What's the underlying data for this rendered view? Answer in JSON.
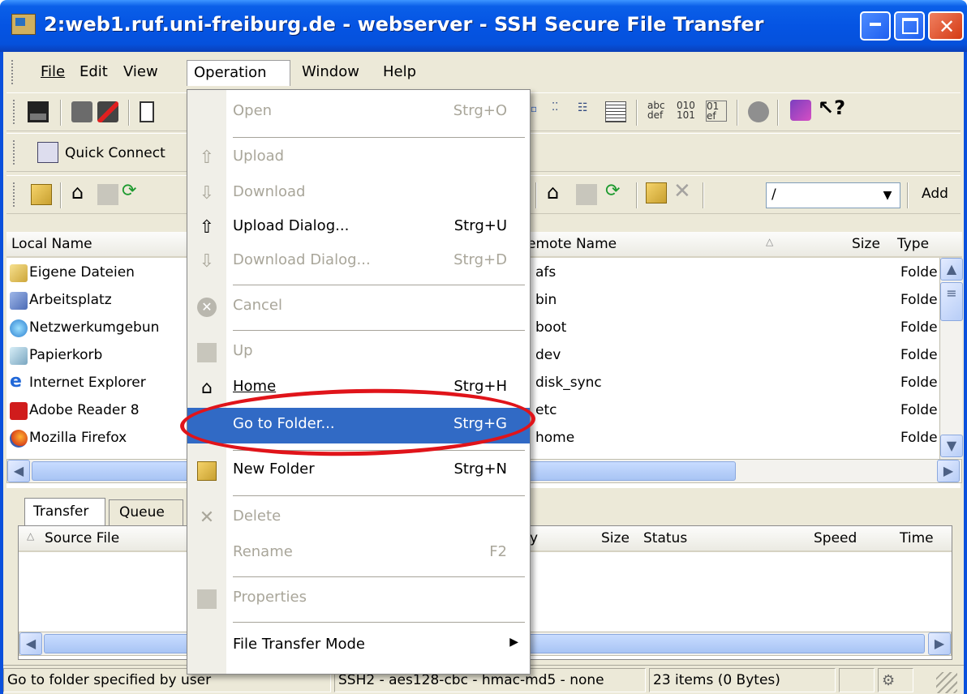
{
  "window": {
    "title": "2:web1.ruf.uni-freiburg.de - webserver - SSH Secure File Transfer",
    "minimize_label": "_",
    "maximize_label": "□",
    "close_label": "✕"
  },
  "menubar": {
    "items": [
      "File",
      "Edit",
      "View",
      "Operation",
      "Window",
      "Help"
    ],
    "active": "Operation"
  },
  "toolbar2": {
    "quick_connect": "Quick Connect"
  },
  "remote_toolbar": {
    "path_value": "/",
    "add_label": "Add"
  },
  "local_pane": {
    "header": "Local Name",
    "items": [
      "Eigene Dateien",
      "Arbeitsplatz",
      "Netzwerkumgebun",
      "Papierkorb",
      "Internet Explorer",
      "Adobe Reader 8",
      "Mozilla Firefox"
    ]
  },
  "remote_pane": {
    "headers": {
      "name": "emote Name",
      "size": "Size",
      "type": "Type"
    },
    "items": [
      {
        "name": "afs",
        "type": "Folde"
      },
      {
        "name": "bin",
        "type": "Folde"
      },
      {
        "name": "boot",
        "type": "Folde"
      },
      {
        "name": "dev",
        "type": "Folde"
      },
      {
        "name": "disk_sync",
        "type": "Folde"
      },
      {
        "name": "etc",
        "type": "Folde"
      },
      {
        "name": "home",
        "type": "Folde"
      }
    ]
  },
  "transfer": {
    "tabs": [
      "Transfer",
      "Queue"
    ],
    "headers": {
      "source": "Source File",
      "dest_tail": "y",
      "size": "Size",
      "status": "Status",
      "speed": "Speed",
      "time": "Time"
    }
  },
  "operation_menu": {
    "items": [
      {
        "label": "Open",
        "key": "Strg+O",
        "disabled": true,
        "icon": ""
      },
      {
        "label": "Upload",
        "key": "",
        "disabled": true,
        "icon": "upload-icon"
      },
      {
        "label": "Download",
        "key": "",
        "disabled": true,
        "icon": "download-icon"
      },
      {
        "label": "Upload Dialog...",
        "key": "Strg+U",
        "disabled": false,
        "icon": "upload-icon"
      },
      {
        "label": "Download Dialog...",
        "key": "Strg+D",
        "disabled": true,
        "icon": "download-icon"
      },
      {
        "label": "Cancel",
        "key": "",
        "disabled": true,
        "icon": "cancel-icon"
      },
      {
        "label": "Up",
        "key": "",
        "disabled": true,
        "icon": "folder-up-icon"
      },
      {
        "label": "Home",
        "key": "Strg+H",
        "disabled": false,
        "icon": "home-icon"
      },
      {
        "label": "Go to Folder...",
        "key": "Strg+G",
        "disabled": false,
        "highlighted": true,
        "icon": ""
      },
      {
        "label": "New Folder",
        "key": "Strg+N",
        "disabled": false,
        "icon": "new-folder-icon"
      },
      {
        "label": "Delete",
        "key": "",
        "disabled": true,
        "icon": "delete-icon"
      },
      {
        "label": "Rename",
        "key": "F2",
        "disabled": true,
        "icon": ""
      },
      {
        "label": "Properties",
        "key": "",
        "disabled": true,
        "icon": "properties-icon"
      },
      {
        "label": "File Transfer Mode",
        "key": "",
        "disabled": false,
        "submenu": true,
        "icon": ""
      }
    ]
  },
  "statusbar": {
    "hint": "Go to folder specified by user",
    "connection": "SSH2 - aes128-cbc - hmac-md5 - none",
    "items": "23 items (0 Bytes)"
  },
  "colors": {
    "titlebar": "#0554e3",
    "menu_highlight": "#316ac5",
    "annotation_circle": "#e0141a",
    "face": "#ece9d8"
  }
}
